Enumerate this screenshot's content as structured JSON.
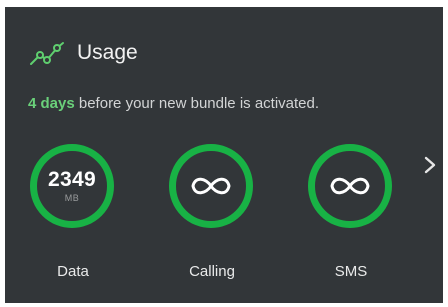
{
  "card": {
    "title": "Usage",
    "title_icon": "usage-graph-icon",
    "notice": {
      "highlight": "4 days",
      "text": " before your new bundle is activated."
    }
  },
  "meters": [
    {
      "label": "Data",
      "value": "2349",
      "unit": "MB",
      "icon": null
    },
    {
      "label": "Calling",
      "value": null,
      "unit": null,
      "icon": "infinity-icon"
    },
    {
      "label": "SMS",
      "value": null,
      "unit": null,
      "icon": "infinity-icon"
    }
  ],
  "next_icon": "chevron-right-icon",
  "colors": {
    "background": "#323639",
    "accent": "#18b245",
    "highlight_text": "#6ad07a",
    "text_primary": "#ffffff",
    "text_secondary": "#d2d4d5"
  }
}
